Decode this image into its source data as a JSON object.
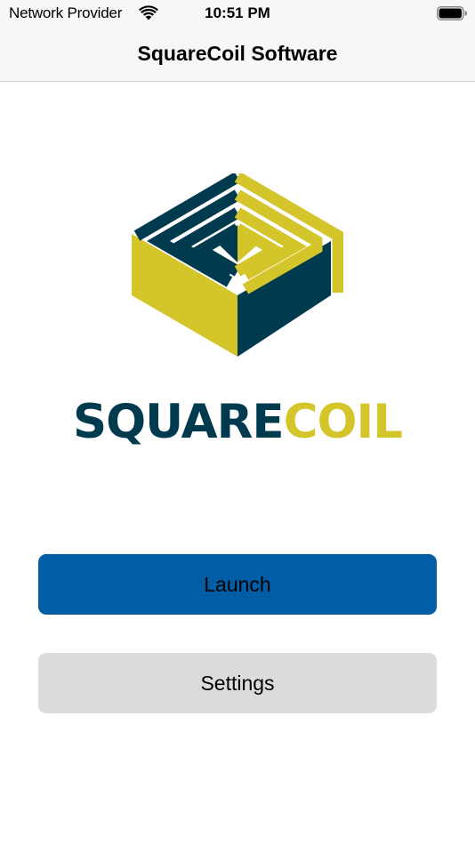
{
  "status_bar": {
    "carrier": "Network Provider",
    "wifi_icon": "wifi-icon",
    "time": "10:51 PM",
    "battery_icon": "battery-full-icon"
  },
  "nav": {
    "title": "SquareCoil Software"
  },
  "logo": {
    "mark_icon": "squarecoil-maze-cube-logo",
    "word_part1": "SQUARE",
    "word_part2": "COIL",
    "colors": {
      "navy": "#003a4f",
      "yellow": "#d4c52a"
    }
  },
  "buttons": {
    "launch_label": "Launch",
    "settings_label": "Settings"
  },
  "colors": {
    "launch_button": "#005da6",
    "settings_button": "#dcdcdc",
    "bar_background": "#f7f7f7"
  }
}
